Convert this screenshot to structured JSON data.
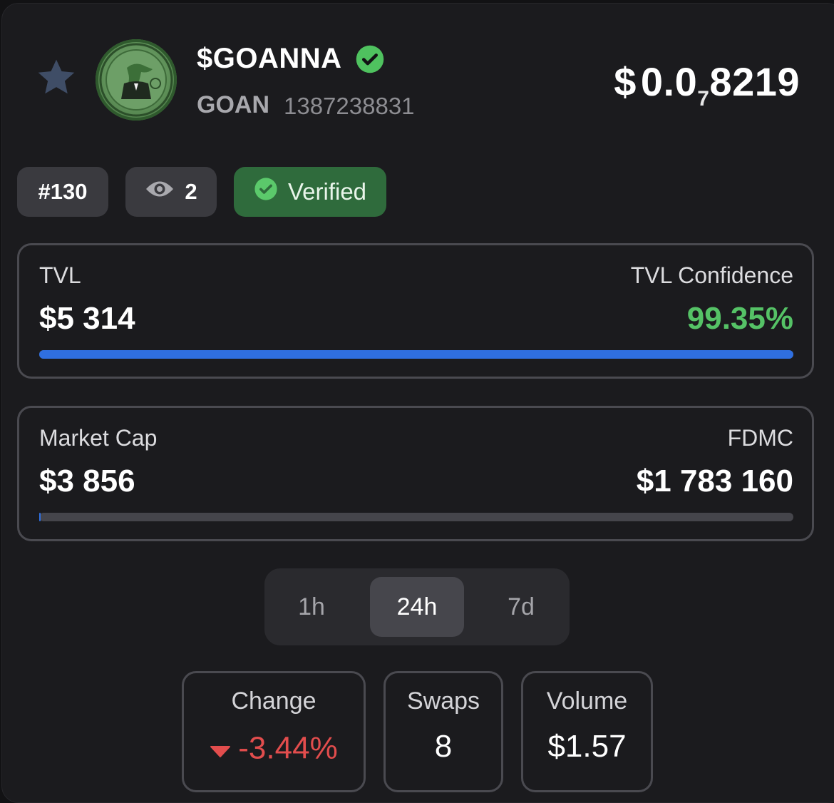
{
  "header": {
    "name": "$GOANNA",
    "ticker": "GOAN",
    "token_id": "1387238831",
    "price": {
      "currency": "$",
      "lead": "0.0",
      "zero_count": "7",
      "digits": "8219"
    },
    "favorite_icon": "star-icon",
    "verified_icon": "check-circle-icon"
  },
  "chips": {
    "rank": "#130",
    "watchers": "2",
    "watch_icon": "eye-icon",
    "verified": "Verified"
  },
  "tvl_card": {
    "left_label": "TVL",
    "right_label": "TVL Confidence",
    "left_value": "$5 314",
    "right_value": "99.35%",
    "bar_fraction": 1.0,
    "bar_color": "#2f6fe0",
    "right_value_color": "#55c266"
  },
  "market_card": {
    "left_label": "Market Cap",
    "right_label": "FDMC",
    "left_value": "$3 856",
    "right_value": "$1 783 160",
    "bar_fraction": 0.002,
    "bar_color": "#2f6fe0"
  },
  "timeframe": {
    "options": [
      "1h",
      "24h",
      "7d"
    ],
    "selected": "24h"
  },
  "stats": {
    "change_label": "Change",
    "change_value": "-3.44%",
    "change_color": "#e24d4d",
    "change_icon": "caret-down-icon",
    "swaps_label": "Swaps",
    "swaps_value": "8",
    "volume_label": "Volume",
    "volume_value": "$1.57"
  },
  "colors": {
    "background": "#121214",
    "panel": "#1b1b1e",
    "verified_green": "#2f6b3c",
    "accent_blue": "#2f6fe0"
  }
}
